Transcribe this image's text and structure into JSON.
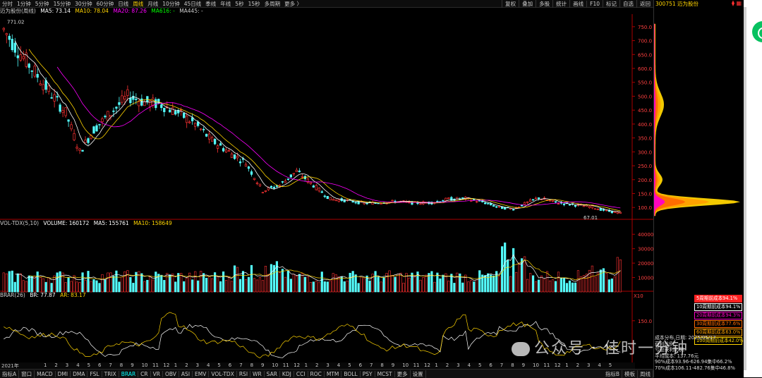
{
  "topbar": {
    "left_tabs": [
      "分时",
      "1分钟",
      "5分钟",
      "15分钟",
      "30分钟",
      "60分钟",
      "日线",
      "周线",
      "月线",
      "10分钟",
      "45日线",
      "季线",
      "年线",
      "5秒",
      "15秒",
      "多周期",
      "更多 〉"
    ],
    "selected_tab": "周线",
    "right_tabs": [
      "复权",
      "叠加",
      "多股",
      "统计",
      "画线",
      "F10",
      "标记",
      "自选",
      "返回"
    ]
  },
  "stock": {
    "code": "300751",
    "name": "迈为股份"
  },
  "main_panel": {
    "title": "迈为股份(周线)",
    "ma5_label": "MA5: 73.14",
    "ma10_label": "MA10: 78.04",
    "ma20_label": "MA20: 87.26",
    "ma616_label": "MA616: -",
    "ma445_label": "MA445: -",
    "high_label": "771.02",
    "low_label": "67.01",
    "price_ticks": [
      "750.0",
      "700.0",
      "650.0",
      "600.0",
      "550.0",
      "500.0",
      "450.0",
      "400.0",
      "350.0",
      "300.0",
      "250.0",
      "200.0",
      "150.0",
      "100.0"
    ]
  },
  "volume_panel": {
    "title": "VOL-TDX(5,10)",
    "volume_label": "VOLUME: 160172",
    "ma5_label": "MA5: 155761",
    "ma10_label": "MA10: 158649",
    "ticks": [
      "40000",
      "30000",
      "20000",
      "10000"
    ],
    "unit": "X10"
  },
  "indicator_panel": {
    "title": "BRAR(26)",
    "br_label": "BR: 77.87",
    "ar_label": "AR: 83.17",
    "tick": "150.0"
  },
  "time_axis": {
    "year_label": "2021年",
    "month_labels": [
      "1",
      "2",
      "3",
      "4",
      "5",
      "6",
      "7",
      "8",
      "9",
      "10",
      "11",
      "12",
      "1",
      "2",
      "3",
      "4",
      "5",
      "6",
      "7",
      "8",
      "9",
      "10",
      "11",
      "12",
      "1",
      "2",
      "3",
      "4",
      "5",
      "6",
      "7",
      "8",
      "9",
      "10",
      "11",
      "12",
      "1",
      "2",
      "3",
      "4",
      "5",
      "6",
      "7",
      "8",
      "9",
      "10",
      "11",
      "12",
      "1",
      "2",
      "3",
      "4",
      "5"
    ]
  },
  "bottom_tabs": {
    "items": [
      "指标A",
      "窗口",
      "MACD",
      "DMI",
      "DMA",
      "FSL",
      "TRIX",
      "BRAR",
      "CR",
      "VR",
      "OBV",
      "ASI",
      "EMV",
      "VOL-TDX",
      "RSI",
      "WR",
      "SAR",
      "KDJ",
      "CCI",
      "ROC",
      "MTM",
      "BOLL",
      "PSY",
      "MCST",
      "更多",
      "设置"
    ],
    "selected": "BRAR",
    "right_items": [
      "指标B",
      "模板"
    ],
    "period": "周线"
  },
  "chip_legend": [
    {
      "label": "5周期前成本94.1%",
      "color": "#ff2020"
    },
    {
      "label": "10周期前成本94.1%",
      "color": "#ffffff"
    },
    {
      "label": "20周期前成本94.3%",
      "color": "#ff00c8"
    },
    {
      "label": "30周期前成本77.6%",
      "color": "#ff6a00"
    },
    {
      "label": "60周期前成本63.0%",
      "color": "#ffa000"
    },
    {
      "label": "100周期前成本42.0%",
      "color": "#ffd400"
    }
  ],
  "chip_stats": [
    "成本分布,日期: 2025/05/17",
    "获利比例:",
    "亏盈获利比例:",
    "平均成本: 137.76元",
    "90%成本93.96-626.94集中66.2%",
    "70%成本106.11-482.76集中46.8%"
  ],
  "watermark": "公众号 · 佳时一分钟",
  "colors": {
    "up": "#ff3333",
    "down": "#54ffff",
    "ma5": "#ffffff",
    "ma10": "#ffd400",
    "ma20": "#ff00ff",
    "bg": "#000000",
    "axis": "#cc0000"
  }
}
